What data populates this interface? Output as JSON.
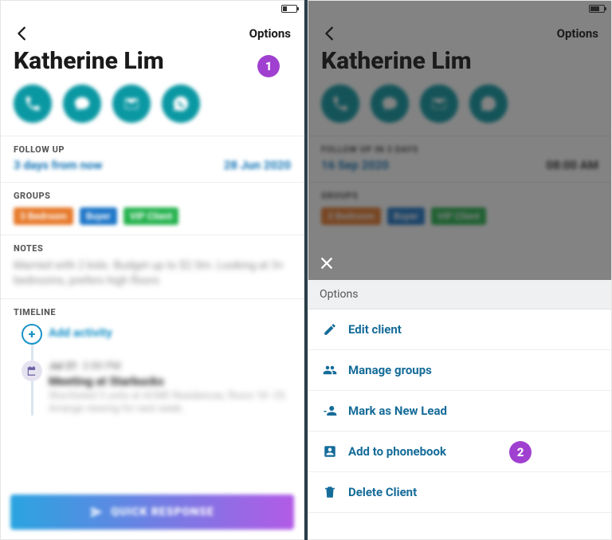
{
  "left": {
    "options_label": "Options",
    "title": "Katherine Lim",
    "followup": {
      "label": "FOLLOW UP",
      "left": "3 days from now",
      "right": "28 Jun 2020"
    },
    "groups": {
      "label": "GROUPS",
      "chips": [
        "3 Bedroom",
        "Buyer",
        "VIP Client"
      ]
    },
    "notes": {
      "label": "NOTES",
      "text": "Married with 2 kids. Budget up to $2.5m. Looking at 3+ bedrooms, prefers high floors"
    },
    "timeline": {
      "label": "TIMELINE",
      "add_label": "Add activity",
      "item": {
        "date": "Jul 21",
        "time": "2:00 PM",
        "title": "Meeting at Starbucks",
        "desc": "Shortlisted 5 units at ACME Residences, floors 18–25. Arrange viewing for next week."
      }
    },
    "quick_response": "QUICK RESPONSE",
    "marker": "1"
  },
  "right": {
    "options_label": "Options",
    "title": "Katherine Lim",
    "followup": {
      "label": "FOLLOW UP IN  3 DAYS",
      "left": "16 Sep 2020",
      "right": "08:00 AM"
    },
    "groups": {
      "label": "GROUPS",
      "chips": [
        "3 Bedroom",
        "Buyer",
        "VIP Client"
      ]
    },
    "sheet": {
      "header": "Options",
      "edit": "Edit client",
      "manage": "Manage groups",
      "mark": "Mark as New Lead",
      "add": "Add to phonebook",
      "delete": "Delete Client"
    },
    "marker": "2"
  }
}
